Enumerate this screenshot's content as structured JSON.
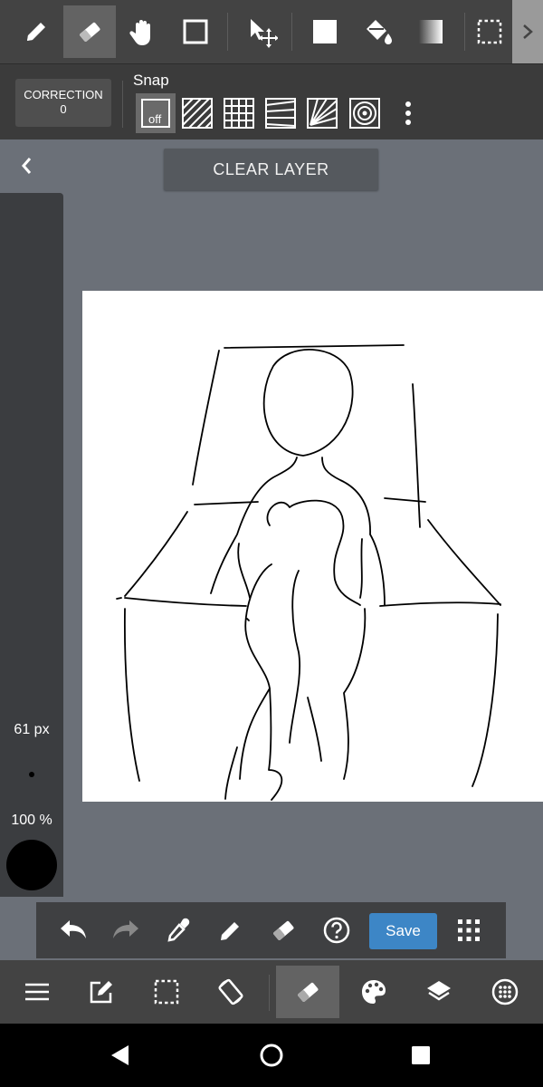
{
  "top_toolbar": {
    "tools": [
      {
        "name": "pen-tool",
        "icon": "pencil-icon"
      },
      {
        "name": "eraser-tool",
        "icon": "eraser-icon",
        "active": true
      },
      {
        "name": "hand-tool",
        "icon": "hand-icon"
      },
      {
        "name": "shape-tool",
        "icon": "square-outline-icon"
      },
      {
        "name": "move-tool",
        "icon": "move-arrow-icon"
      },
      {
        "name": "fill-rect-tool",
        "icon": "filled-square-icon"
      },
      {
        "name": "bucket-tool",
        "icon": "paint-bucket-icon"
      },
      {
        "name": "gradient-tool",
        "icon": "gradient-icon"
      },
      {
        "name": "select-tool",
        "icon": "dashed-square-icon"
      }
    ],
    "more_icon": "chevron-right-icon"
  },
  "option_bar": {
    "correction_label": "CORRECTION",
    "correction_value": "0",
    "snap_label": "Snap",
    "snap_off_label": "off",
    "snap_modes": [
      "off",
      "parallel",
      "grid",
      "perspective-lines",
      "radial",
      "concentric"
    ]
  },
  "canvas": {
    "clear_layer_label": "CLEAR LAYER",
    "brush_size": "61 px",
    "opacity": "100 %",
    "color": "#000000"
  },
  "action_bar": {
    "icons": [
      "undo-icon",
      "redo-icon",
      "eyedropper-icon",
      "pen-icon",
      "eraser-icon",
      "help-icon"
    ],
    "save_label": "Save",
    "grid_icon": "dots-grid-icon"
  },
  "bottom_toolbar": {
    "icons": [
      "menu-icon",
      "edit-icon",
      "selection-icon",
      "rotate-icon",
      "eraser-icon",
      "palette-icon",
      "layers-icon",
      "material-icon"
    ],
    "active": "eraser-icon"
  },
  "nav_bar": {
    "icons": [
      "back-triangle-icon",
      "home-circle-icon",
      "recents-square-icon"
    ]
  },
  "colors": {
    "toolbar_bg": "#434343",
    "canvas_bg": "#6b7078",
    "accent": "#3d86c6"
  }
}
